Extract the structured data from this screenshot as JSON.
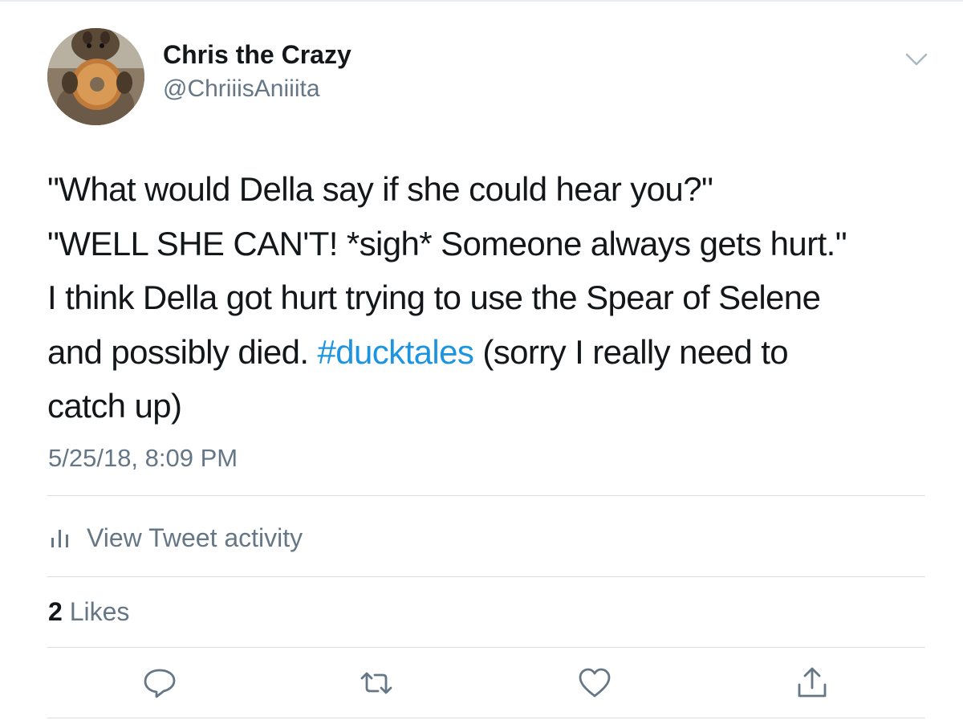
{
  "tweet": {
    "author": {
      "display_name": "Chris the Crazy",
      "handle": "@ChriiisAniiita",
      "avatar_icon": "squirrel-with-donut-avatar"
    },
    "text_lines": [
      "\"What would Della say if she could hear you?\"",
      "\"WELL SHE CAN'T! *sigh* Someone always gets hurt.\"",
      "I think Della got hurt trying to use the Spear of Selene",
      "and possibly died. ",
      "catch up)"
    ],
    "hashtag": "#ducktales",
    "text_after_hashtag": " (sorry I really need to",
    "timestamp": "5/25/18, 8:09 PM",
    "activity_label": "View Tweet activity",
    "likes": {
      "count": "2",
      "label": "Likes"
    },
    "actions": {
      "reply_icon": "reply-icon",
      "retweet_icon": "retweet-icon",
      "like_icon": "heart-icon",
      "share_icon": "share-icon",
      "more_icon": "chevron-down-icon"
    }
  },
  "colors": {
    "text_primary": "#14171a",
    "text_secondary": "#657786",
    "link": "#1b95e0",
    "divider": "#d8dee2"
  }
}
